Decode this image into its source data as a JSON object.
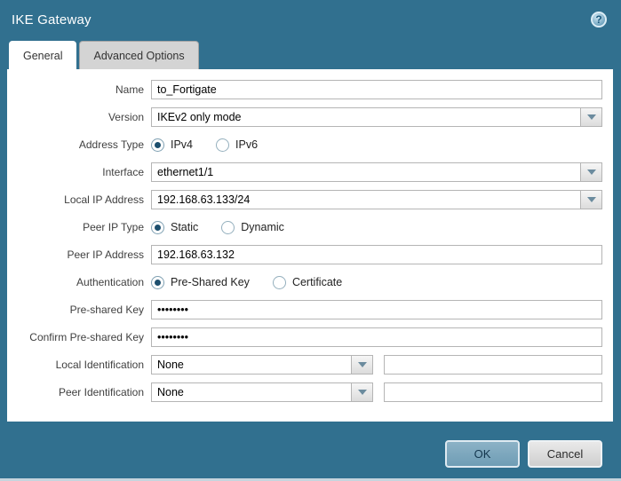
{
  "window": {
    "title": "IKE Gateway",
    "help_icon_glyph": "?"
  },
  "tabs": [
    {
      "label": "General",
      "active": true
    },
    {
      "label": "Advanced Options",
      "active": false
    }
  ],
  "form": {
    "name": {
      "label": "Name",
      "value": "to_Fortigate"
    },
    "version": {
      "label": "Version",
      "value": "IKEv2 only mode"
    },
    "address_type": {
      "label": "Address Type",
      "options": [
        "IPv4",
        "IPv6"
      ],
      "selected": "IPv4"
    },
    "interface": {
      "label": "Interface",
      "value": "ethernet1/1"
    },
    "local_ip": {
      "label": "Local IP Address",
      "value": "192.168.63.133/24"
    },
    "peer_ip_type": {
      "label": "Peer IP Type",
      "options": [
        "Static",
        "Dynamic"
      ],
      "selected": "Static"
    },
    "peer_ip": {
      "label": "Peer IP Address",
      "value": "192.168.63.132"
    },
    "authentication": {
      "label": "Authentication",
      "options": [
        "Pre-Shared Key",
        "Certificate"
      ],
      "selected": "Pre-Shared Key"
    },
    "preshared_key": {
      "label": "Pre-shared Key",
      "value": "••••••••"
    },
    "confirm_preshared_key": {
      "label": "Confirm Pre-shared Key",
      "value": "••••••••"
    },
    "local_identification": {
      "label": "Local Identification",
      "value": "None",
      "extra_value": ""
    },
    "peer_identification": {
      "label": "Peer Identification",
      "value": "None",
      "extra_value": ""
    }
  },
  "footer": {
    "ok_label": "OK",
    "cancel_label": "Cancel"
  },
  "colors": {
    "window-bg": "#31708f",
    "ok-bg": "#6f9db5",
    "radio-dot": "#1d4f6e",
    "caret-color": "#6b8b9e"
  }
}
